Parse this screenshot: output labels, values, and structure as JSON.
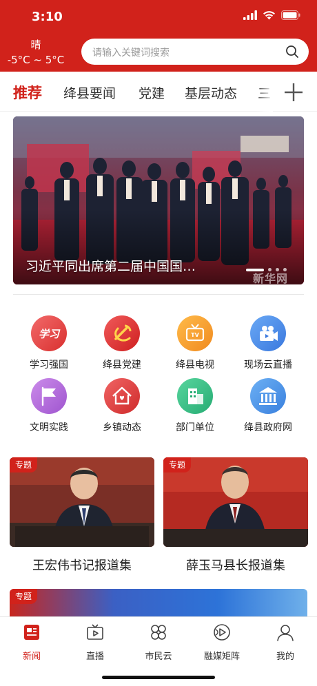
{
  "status_bar": {
    "time": "3:10"
  },
  "header": {
    "weather": {
      "condition": "晴",
      "temperature": "-5°C ~ 5°C"
    },
    "search": {
      "placeholder": "请输入关键词搜索",
      "icon": "search-icon"
    }
  },
  "channels": {
    "tabs": [
      {
        "label": "推荐",
        "active": true
      },
      {
        "label": "绛县要闻",
        "active": false
      },
      {
        "label": "党建",
        "active": false
      },
      {
        "label": "基层动态",
        "active": false
      },
      {
        "label": "三",
        "active": false
      }
    ],
    "add_icon": "plus-icon"
  },
  "banner": {
    "caption": "习近平同出席第二届中国国…",
    "watermark": "新华网",
    "slide_count": 4,
    "active_slide": 1
  },
  "quick_links": [
    {
      "label": "学习强国",
      "icon": "xuexi-icon",
      "color": "#e84a4a"
    },
    {
      "label": "绛县党建",
      "icon": "party-emblem-icon",
      "color": "#e23b3b"
    },
    {
      "label": "绛县电视",
      "icon": "tv-icon",
      "color": "#f5a331"
    },
    {
      "label": "现场云直播",
      "icon": "video-camera-icon",
      "color": "#4a8de8"
    },
    {
      "label": "文明实践",
      "icon": "flag-icon",
      "color": "#b76bd8"
    },
    {
      "label": "乡镇动态",
      "icon": "house-icon",
      "color": "#e04848"
    },
    {
      "label": "部门单位",
      "icon": "building-icon",
      "color": "#3fc48a"
    },
    {
      "label": "绛县政府网",
      "icon": "government-icon",
      "color": "#4a92e6"
    }
  ],
  "topics": [
    {
      "tag": "专题",
      "title": "王宏伟书记报道集"
    },
    {
      "tag": "专题",
      "title": "薛玉马县长报道集"
    },
    {
      "tag": "专题"
    }
  ],
  "bottom_nav": [
    {
      "label": "新闻",
      "icon": "news-icon",
      "active": true
    },
    {
      "label": "直播",
      "icon": "live-icon",
      "active": false
    },
    {
      "label": "市民云",
      "icon": "grid-icon",
      "active": false
    },
    {
      "label": "融媒矩阵",
      "icon": "media-icon",
      "active": false
    },
    {
      "label": "我的",
      "icon": "profile-icon",
      "active": false
    }
  ],
  "colors": {
    "brand": "#d1221b",
    "tab_active": "#d1221b",
    "nav_active": "#d1221b"
  }
}
